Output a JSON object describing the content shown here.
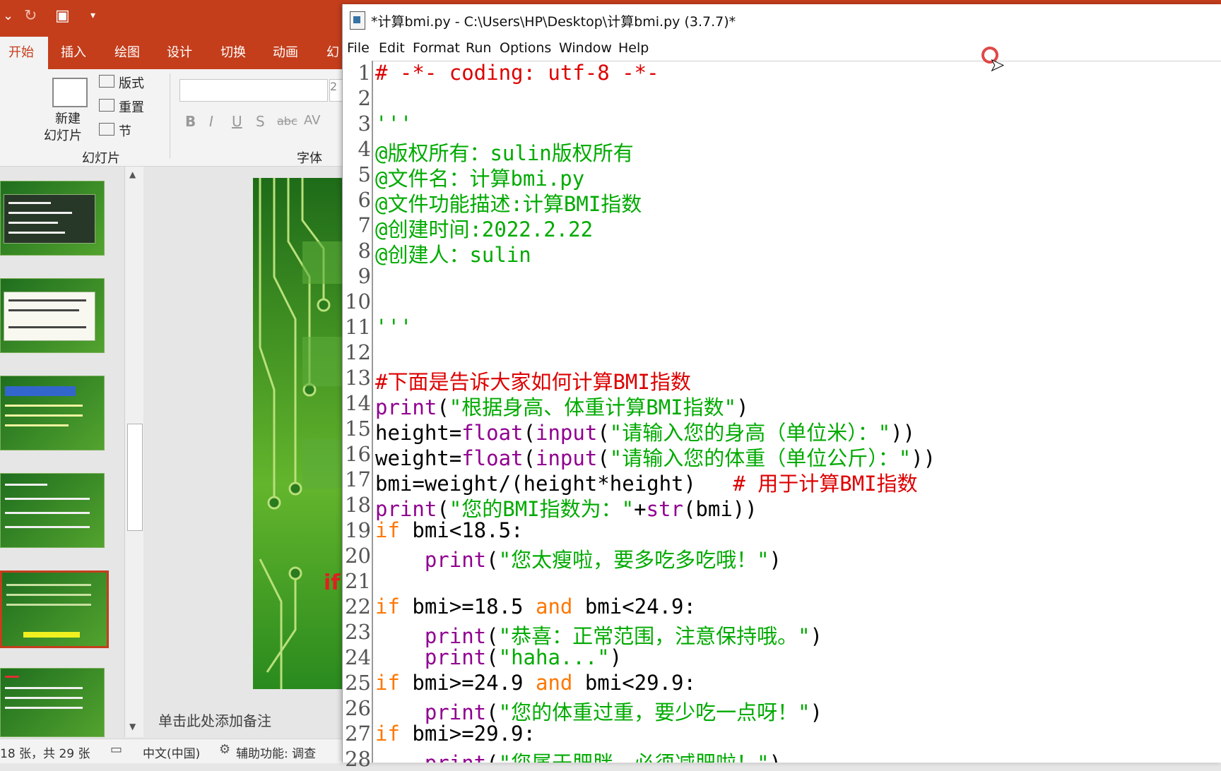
{
  "ppt": {
    "tabs": [
      "开始",
      "插入",
      "绘图",
      "设计",
      "切换",
      "动画",
      "幻"
    ],
    "ribbon": {
      "new_slide_label_1": "新建",
      "new_slide_label_2": "幻灯片",
      "layout_label": "版式",
      "reset_label": "重置",
      "section_label": "节",
      "group_slides": "幻灯片",
      "group_font": "字体",
      "font_size_partial": "2"
    },
    "notes_placeholder": "单击此处添加备注",
    "status": {
      "slide_count": "18 张，共 29 张",
      "language": "中文(中国)",
      "accessibility": "辅助功能: 调查"
    }
  },
  "idle": {
    "title": "*计算bmi.py - C:\\Users\\HP\\Desktop\\计算bmi.py (3.7.7)*",
    "menu": [
      "File",
      "Edit",
      "Format",
      "Run",
      "Options",
      "Window",
      "Help"
    ],
    "lines": [
      {
        "n": "1",
        "segs": [
          {
            "c": "comment",
            "t": "# -*- coding: utf-8 -*-"
          }
        ]
      },
      {
        "n": "2",
        "segs": []
      },
      {
        "n": "3",
        "segs": [
          {
            "c": "string",
            "t": "'''"
          }
        ]
      },
      {
        "n": "4",
        "segs": [
          {
            "c": "string",
            "t": "@版权所有：sulin版权所有"
          }
        ]
      },
      {
        "n": "5",
        "segs": [
          {
            "c": "string",
            "t": "@文件名：计算bmi.py"
          }
        ]
      },
      {
        "n": "6",
        "segs": [
          {
            "c": "string",
            "t": "@文件功能描述:计算BMI指数"
          }
        ]
      },
      {
        "n": "7",
        "segs": [
          {
            "c": "string",
            "t": "@创建时间:2022.2.22"
          }
        ]
      },
      {
        "n": "8",
        "segs": [
          {
            "c": "string",
            "t": "@创建人：sulin"
          }
        ]
      },
      {
        "n": "9",
        "segs": []
      },
      {
        "n": "10",
        "segs": []
      },
      {
        "n": "11",
        "segs": [
          {
            "c": "string",
            "t": "'''"
          }
        ]
      },
      {
        "n": "12",
        "segs": []
      },
      {
        "n": "13",
        "segs": [
          {
            "c": "comment",
            "t": "#下面是告诉大家如何计算BMI指数"
          }
        ]
      },
      {
        "n": "14",
        "segs": [
          {
            "c": "builtin",
            "t": "print"
          },
          {
            "c": "plain",
            "t": "("
          },
          {
            "c": "string",
            "t": "\"根据身高、体重计算BMI指数\""
          },
          {
            "c": "plain",
            "t": ")"
          }
        ]
      },
      {
        "n": "15",
        "segs": [
          {
            "c": "plain",
            "t": "height="
          },
          {
            "c": "builtin",
            "t": "float"
          },
          {
            "c": "plain",
            "t": "("
          },
          {
            "c": "builtin",
            "t": "input"
          },
          {
            "c": "plain",
            "t": "("
          },
          {
            "c": "string",
            "t": "\"请输入您的身高（单位米）：\""
          },
          {
            "c": "plain",
            "t": "))"
          }
        ]
      },
      {
        "n": "16",
        "segs": [
          {
            "c": "plain",
            "t": "weight="
          },
          {
            "c": "builtin",
            "t": "float"
          },
          {
            "c": "plain",
            "t": "("
          },
          {
            "c": "builtin",
            "t": "input"
          },
          {
            "c": "plain",
            "t": "("
          },
          {
            "c": "string",
            "t": "\"请输入您的体重（单位公斤）：\""
          },
          {
            "c": "plain",
            "t": "))"
          }
        ]
      },
      {
        "n": "17",
        "segs": [
          {
            "c": "plain",
            "t": "bmi=weight/(height*height)   "
          },
          {
            "c": "comment",
            "t": "# 用于计算BMI指数"
          }
        ]
      },
      {
        "n": "18",
        "segs": [
          {
            "c": "builtin",
            "t": "print"
          },
          {
            "c": "plain",
            "t": "("
          },
          {
            "c": "string",
            "t": "\"您的BMI指数为：\""
          },
          {
            "c": "plain",
            "t": "+"
          },
          {
            "c": "builtin",
            "t": "str"
          },
          {
            "c": "plain",
            "t": "(bmi))"
          }
        ]
      },
      {
        "n": "19",
        "segs": [
          {
            "c": "kw",
            "t": "if"
          },
          {
            "c": "plain",
            "t": " bmi<18.5:"
          }
        ]
      },
      {
        "n": "20",
        "segs": [
          {
            "c": "plain",
            "t": "    "
          },
          {
            "c": "builtin",
            "t": "print"
          },
          {
            "c": "plain",
            "t": "("
          },
          {
            "c": "string",
            "t": "\"您太瘦啦，要多吃多吃哦！\""
          },
          {
            "c": "plain",
            "t": ")"
          }
        ]
      },
      {
        "n": "21",
        "segs": []
      },
      {
        "n": "22",
        "segs": [
          {
            "c": "kw",
            "t": "if"
          },
          {
            "c": "plain",
            "t": " bmi>=18.5 "
          },
          {
            "c": "kw",
            "t": "and"
          },
          {
            "c": "plain",
            "t": " bmi<24.9:"
          }
        ]
      },
      {
        "n": "23",
        "segs": [
          {
            "c": "plain",
            "t": "    "
          },
          {
            "c": "builtin",
            "t": "print"
          },
          {
            "c": "plain",
            "t": "("
          },
          {
            "c": "string",
            "t": "\"恭喜：正常范围，注意保持哦。\""
          },
          {
            "c": "plain",
            "t": ")"
          }
        ]
      },
      {
        "n": "24",
        "segs": [
          {
            "c": "plain",
            "t": "    "
          },
          {
            "c": "builtin",
            "t": "print"
          },
          {
            "c": "plain",
            "t": "("
          },
          {
            "c": "string",
            "t": "\"haha...\""
          },
          {
            "c": "plain",
            "t": ")"
          }
        ]
      },
      {
        "n": "25",
        "segs": [
          {
            "c": "kw",
            "t": "if"
          },
          {
            "c": "plain",
            "t": " bmi>=24.9 "
          },
          {
            "c": "kw",
            "t": "and"
          },
          {
            "c": "plain",
            "t": " bmi<29.9:"
          }
        ]
      },
      {
        "n": "26",
        "segs": [
          {
            "c": "plain",
            "t": "    "
          },
          {
            "c": "builtin",
            "t": "print"
          },
          {
            "c": "plain",
            "t": "("
          },
          {
            "c": "string",
            "t": "\"您的体重过重，要少吃一点呀！\""
          },
          {
            "c": "plain",
            "t": ")"
          }
        ]
      },
      {
        "n": "27",
        "segs": [
          {
            "c": "kw",
            "t": "if"
          },
          {
            "c": "plain",
            "t": " bmi>=29.9:"
          }
        ]
      },
      {
        "n": "28",
        "segs": [
          {
            "c": "plain",
            "t": "    "
          },
          {
            "c": "builtin",
            "t": "print"
          },
          {
            "c": "plain",
            "t": "("
          },
          {
            "c": "string",
            "t": "\"您属于肥胖，必须减肥啦！\""
          },
          {
            "c": "plain",
            "t": ")"
          }
        ]
      }
    ]
  },
  "colors": {
    "ppt_accent": "#c43e1c",
    "comment": "#dd0000",
    "string": "#00aa00",
    "keyword": "#ff7700",
    "builtin": "#900090"
  }
}
